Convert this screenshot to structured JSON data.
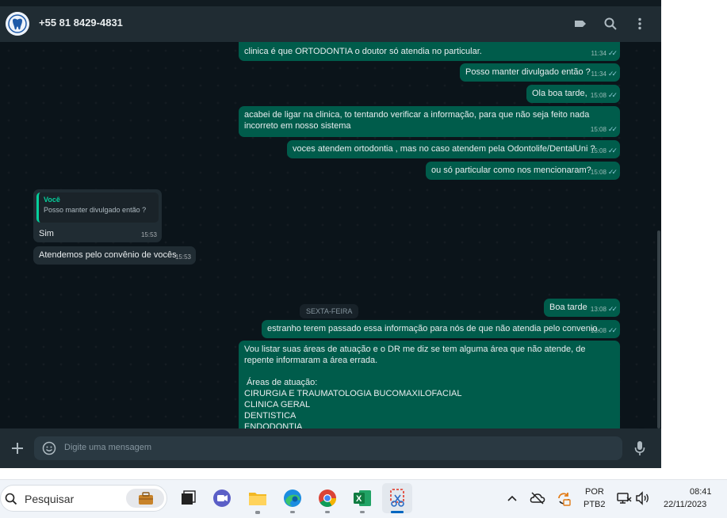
{
  "header": {
    "contact": "+55 81 8429-4831"
  },
  "messages": {
    "m0": {
      "text": "clinica é que ORTODONTIA o doutor só atendia no particular.",
      "time": "11:34"
    },
    "m1": {
      "text": "Posso manter divulgado então ?",
      "time": "11:34"
    },
    "m2": {
      "text": "Ola boa tarde,",
      "time": "15:08"
    },
    "m3": {
      "text": "acabei de ligar na clinica, to tentando verificar a informação, para que não seja feito nada incorreto em nosso sistema",
      "time": "15:08"
    },
    "m4": {
      "text": "voces atendem ortodontia , mas no caso atendem pela Odontolife/DentalUni ?",
      "time": "15:08"
    },
    "m5": {
      "text": "ou só particular como nos mencionaram?",
      "time": "15:08"
    },
    "in1": {
      "quote_author": "Você",
      "quote_text": "Posso manter divulgado então ?",
      "text": "Sim",
      "time": "15:53"
    },
    "in2": {
      "text": "Atendemos pelo convênio de vocês",
      "time": "15:53"
    },
    "day_separator": "SEXTA-FEIRA",
    "m6": {
      "text": "Boa tarde",
      "time": "13:08"
    },
    "m7": {
      "text": "estranho terem passado essa informação para nós de que não atendia pelo convenio.",
      "time": "13:08"
    },
    "m8": {
      "line1": "Vou listar suas áreas de atuação e o DR me diz se tem alguma área que não atende, de repente informaram a área errada.",
      "line2": " Áreas de atuação:",
      "line3": "CIRURGIA E TRAUMATOLOGIA BUCOMAXILOFACIAL",
      "line4": "CLINICA GERAL",
      "line5": "DENTISTICA",
      "line6": "ENDODONTIA"
    }
  },
  "composer": {
    "placeholder": "Digite uma mensagem"
  },
  "taskbar": {
    "search_label": "Pesquisar",
    "lang_line1": "POR",
    "lang_line2": "PTB2",
    "time": "08:41",
    "date": "22/11/2023"
  },
  "colors": {
    "outgoing": "#005c4b",
    "incoming": "#202c33",
    "background": "#0b141a",
    "header": "#202c33",
    "ticks": "#53bdeb"
  }
}
